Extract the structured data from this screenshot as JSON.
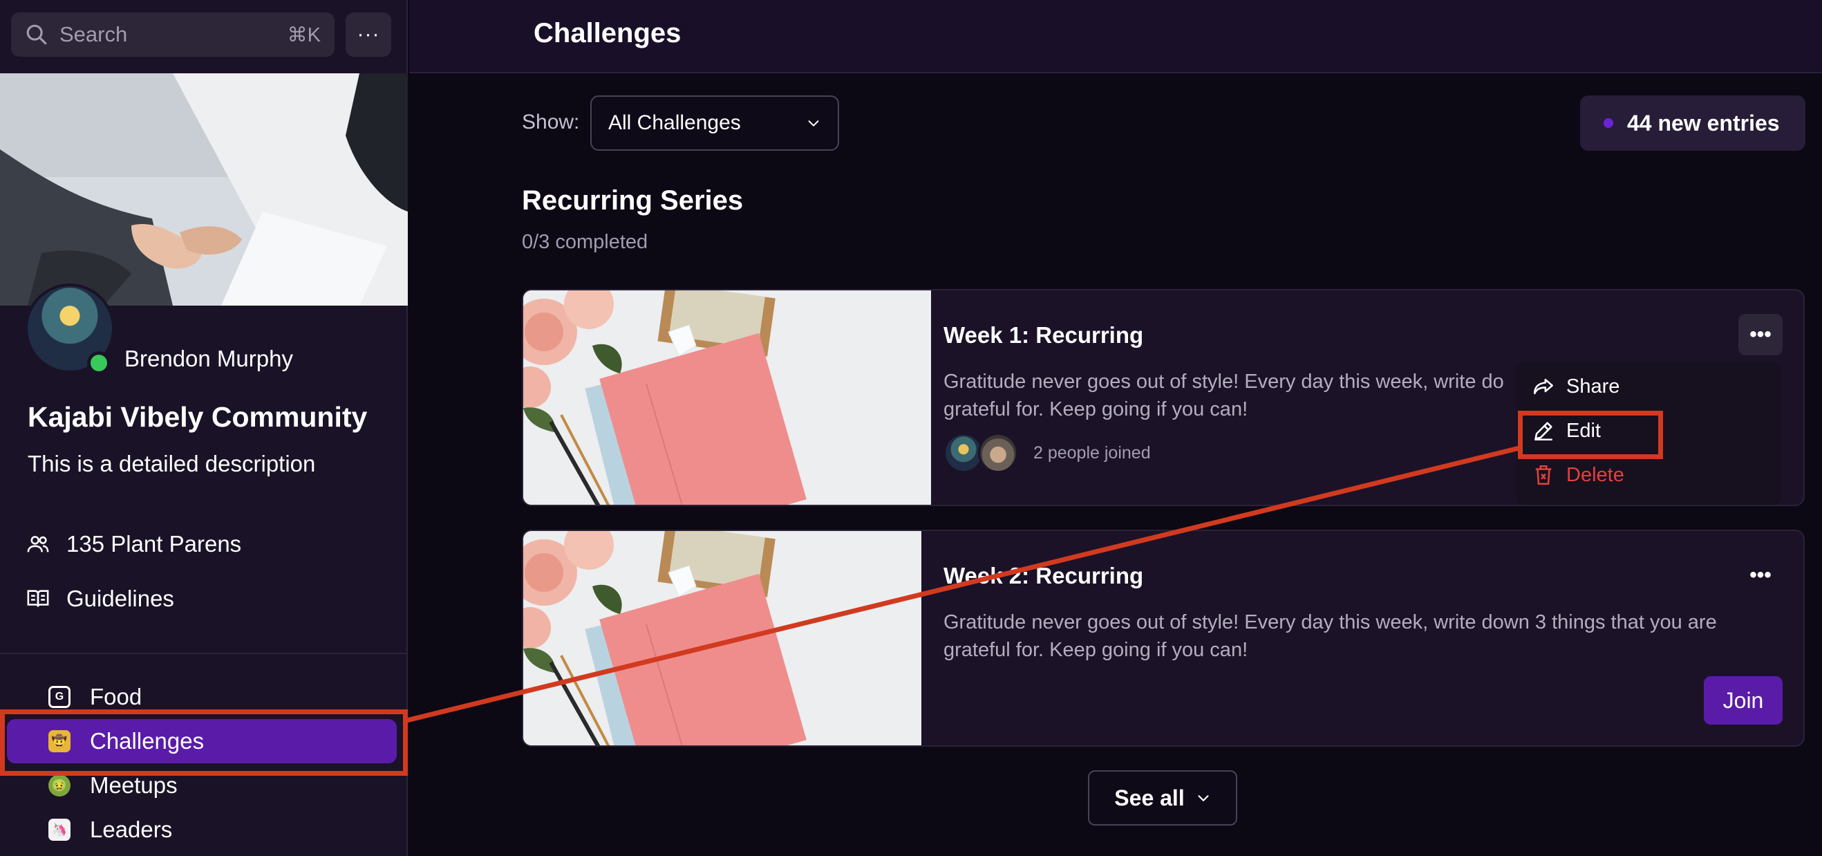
{
  "sidebar": {
    "search": {
      "placeholder": "Search",
      "shortcut": "⌘K",
      "icon": "search-icon"
    },
    "more_label": "···",
    "profile": {
      "name": "Brendon Murphy",
      "status_color": "#37c95b"
    },
    "community": {
      "title": "Kajabi Vibely Community",
      "description": "This is a detailed description"
    },
    "links": [
      {
        "label": "135 Plant Parens",
        "icon": "users-icon"
      },
      {
        "label": "Guidelines",
        "icon": "book-icon"
      }
    ],
    "nav": [
      {
        "label": "Food",
        "icon": "G",
        "active": false
      },
      {
        "label": "Challenges",
        "icon": "🤠",
        "active": true
      },
      {
        "label": "Meetups",
        "icon": "🤢",
        "active": false
      },
      {
        "label": "Leaders",
        "icon": "🦄",
        "active": false
      }
    ]
  },
  "header": {
    "title": "Challenges"
  },
  "filter": {
    "show_label": "Show:",
    "selected": "All Challenges"
  },
  "entries": {
    "label": "44 new entries",
    "accent": "#6a24d8"
  },
  "series": {
    "title": "Recurring Series",
    "progress": "0/3 completed"
  },
  "cards": [
    {
      "title": "Week 1: Recurring",
      "description": "Gratitude never goes out of style! Every day this week, write do",
      "description_line2": "grateful for. Keep going if you can!",
      "joined": "2 people joined",
      "more_label": "•••"
    },
    {
      "title": "Week 2: Recurring",
      "description": "Gratitude never goes out of style! Every day this week, write down 3 things that you are",
      "description_line2": "grateful for. Keep going if you can!",
      "more_label": "•••",
      "join_label": "Join"
    }
  ],
  "menu": {
    "items": [
      {
        "label": "Share",
        "icon": "share-icon"
      },
      {
        "label": "Edit",
        "icon": "pencil-icon"
      },
      {
        "label": "Delete",
        "icon": "trash-icon",
        "color": "#e5403a"
      }
    ]
  },
  "see_all": {
    "label": "See all"
  },
  "colors": {
    "accent": "#5a1ca8",
    "annotation": "#d23a1f",
    "background": "#0c0814"
  }
}
